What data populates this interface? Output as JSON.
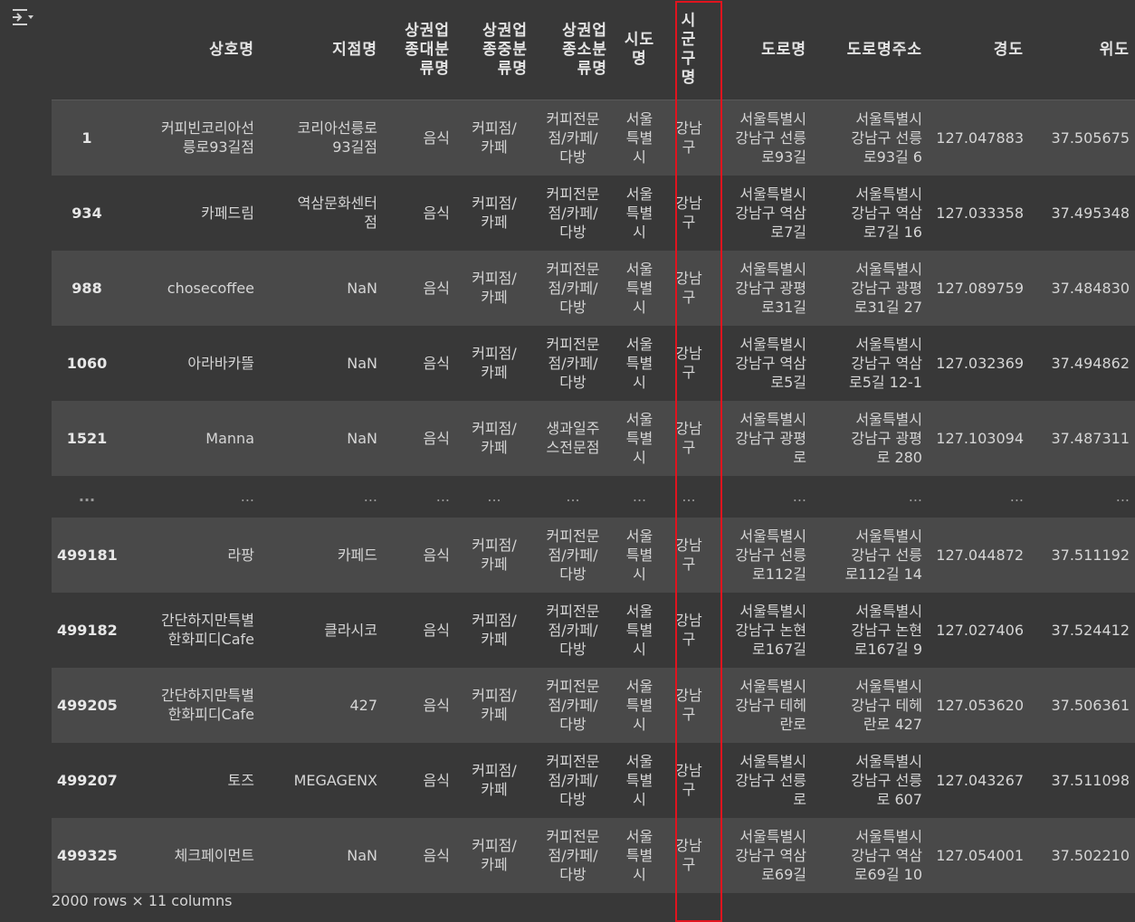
{
  "toggle_icon": "layout-toggle-icon",
  "columns": [
    "상호명",
    "지점명",
    "상권업종대분류명",
    "상권업종중분류명",
    "상권업종소분류명",
    "시도명",
    "시군구명",
    "도로명",
    "도로명주소",
    "경도",
    "위도"
  ],
  "header_lines": [
    "",
    "상호명",
    "지점명",
    "상권업\n종대분\n류명",
    "상권업\n종중분\n류명",
    "상권업\n종소분\n류명",
    "시도\n명",
    "시\n군\n구\n명",
    "도로명",
    "도로명주소",
    "경도",
    "위도"
  ],
  "rows": [
    [
      "1",
      "커피빈코리아선\n릉로93길점",
      "코리아선릉로\n93길점",
      "음식",
      "커피점/\n카페",
      "커피전문\n점/카페/\n다방",
      "서울\n특별\n시",
      "강남\n구",
      "서울특별시\n강남구 선릉\n로93길",
      "서울특별시\n강남구 선릉\n로93길 6",
      "127.047883",
      "37.505675"
    ],
    [
      "934",
      "카페드림",
      "역삼문화센터\n점",
      "음식",
      "커피점/\n카페",
      "커피전문\n점/카페/\n다방",
      "서울\n특별\n시",
      "강남\n구",
      "서울특별시\n강남구 역삼\n로7길",
      "서울특별시\n강남구 역삼\n로7길 16",
      "127.033358",
      "37.495348"
    ],
    [
      "988",
      "chosecoffee",
      "NaN",
      "음식",
      "커피점/\n카페",
      "커피전문\n점/카페/\n다방",
      "서울\n특별\n시",
      "강남\n구",
      "서울특별시\n강남구 광평\n로31길",
      "서울특별시\n강남구 광평\n로31길 27",
      "127.089759",
      "37.484830"
    ],
    [
      "1060",
      "아라바카뜰",
      "NaN",
      "음식",
      "커피점/\n카페",
      "커피전문\n점/카페/\n다방",
      "서울\n특별\n시",
      "강남\n구",
      "서울특별시\n강남구 역삼\n로5길",
      "서울특별시\n강남구 역삼\n로5길 12-1",
      "127.032369",
      "37.494862"
    ],
    [
      "1521",
      "Manna",
      "NaN",
      "음식",
      "커피점/\n카페",
      "생과일주\n스전문점",
      "서울\n특별\n시",
      "강남\n구",
      "서울특별시\n강남구 광평\n로",
      "서울특별시\n강남구 광평\n로 280",
      "127.103094",
      "37.487311"
    ]
  ],
  "ellipsis_row": [
    "...",
    "...",
    "...",
    "...",
    "...",
    "...",
    "...",
    "...",
    "...",
    "...",
    "...",
    "..."
  ],
  "rows_tail": [
    [
      "499181",
      "라팡",
      "카페드",
      "음식",
      "커피점/\n카페",
      "커피전문\n점/카페/\n다방",
      "서울\n특별\n시",
      "강남\n구",
      "서울특별시\n강남구 선릉\n로112길",
      "서울특별시\n강남구 선릉\n로112길 14",
      "127.044872",
      "37.511192"
    ],
    [
      "499182",
      "간단하지만특별\n한화피디Cafe",
      "클라시코",
      "음식",
      "커피점/\n카페",
      "커피전문\n점/카페/\n다방",
      "서울\n특별\n시",
      "강남\n구",
      "서울특별시\n강남구 논현\n로167길",
      "서울특별시\n강남구 논현\n로167길 9",
      "127.027406",
      "37.524412"
    ],
    [
      "499205",
      "간단하지만특별\n한화피디Cafe",
      "427",
      "음식",
      "커피점/\n카페",
      "커피전문\n점/카페/\n다방",
      "서울\n특별\n시",
      "강남\n구",
      "서울특별시\n강남구 테헤\n란로",
      "서울특별시\n강남구 테헤\n란로 427",
      "127.053620",
      "37.506361"
    ],
    [
      "499207",
      "토즈",
      "MEGAGENX",
      "음식",
      "커피점/\n카페",
      "커피전문\n점/카페/\n다방",
      "서울\n특별\n시",
      "강남\n구",
      "서울특별시\n강남구 선릉\n로",
      "서울특별시\n강남구 선릉\n로 607",
      "127.043267",
      "37.511098"
    ],
    [
      "499325",
      "체크페이먼트",
      "NaN",
      "음식",
      "커피점/\n카페",
      "커피전문\n점/카페/\n다방",
      "서울\n특별\n시",
      "강남\n구",
      "서울특별시\n강남구 역삼\n로69길",
      "서울특별시\n강남구 역삼\n로69길 10",
      "127.054001",
      "37.502210"
    ]
  ],
  "summary": "2000 rows × 11 columns",
  "highlight_color": "#e0141e"
}
